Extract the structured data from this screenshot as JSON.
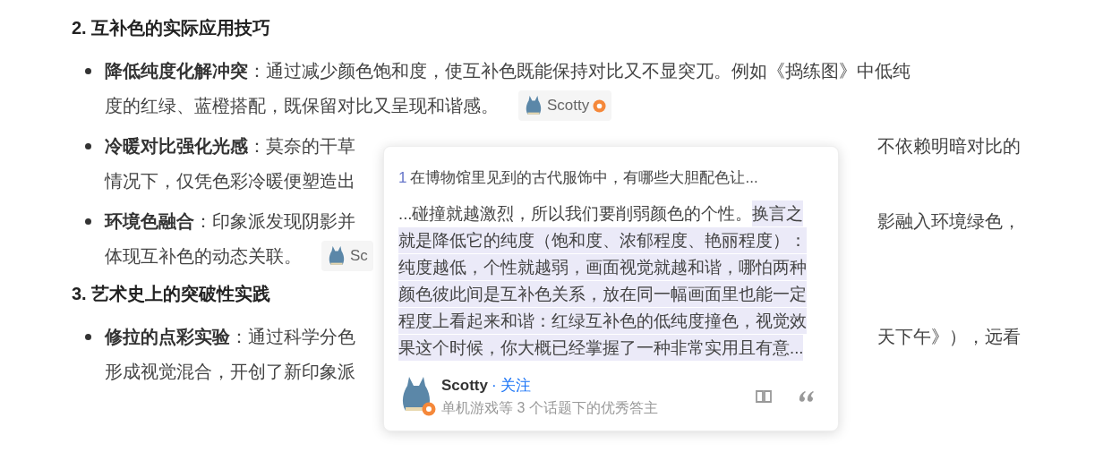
{
  "sections": [
    {
      "heading": "2. 互补色的实际应用技巧",
      "bullets": [
        {
          "lines": [
            {
              "left": "**降低纯度化解冲突**：通过减少颜色饱和度，使互补色既能保持对比又不显突兀。例如《捣练图》中低纯"
            },
            {
              "left": "度的红绿、蓝橙搭配，既保留对比又呈现和谐感。",
              "chip": {
                "name": "Scotty",
                "badge": true
              }
            }
          ]
        },
        {
          "lines": [
            {
              "left": "**冷暖对比强化光感**：莫奈的干草",
              "right": "不依赖明暗对比的"
            },
            {
              "left": "情况下，仅凭色彩冷暖便塑造出"
            }
          ]
        },
        {
          "lines": [
            {
              "left": "**环境色融合**：印象派发现阴影并",
              "right": "影融入环境绿色，"
            },
            {
              "left": "体现互补色的动态关联。",
              "chip": {
                "name": "Sc",
                "badge": false
              }
            }
          ]
        }
      ]
    },
    {
      "heading": "3. 艺术史上的突破性实践",
      "bullets": [
        {
          "lines": [
            {
              "left": "**修拉的点彩实验**：通过科学分色",
              "right": "天下午》），远看"
            },
            {
              "left": "形成视觉混合，开创了新印象派"
            }
          ]
        }
      ]
    }
  ],
  "popup": {
    "index": "1",
    "question": "在博物馆里见到的古代服饰中，有哪些大胆配色让...",
    "excerpt_plain": "...碰撞就越激烈，所以我们要削弱颜色的个性。",
    "excerpt_highlighted": "换言之就是降低它的纯度（饱和度、浓郁程度、艳丽程度）：纯度越低，个性就越弱，画面视觉就越和谐，哪怕两种颜色彼此间是互补色关系，放在同一幅画面里也能一定程度上看起来和谐：红绿互补色的低纯度撞色，视觉效果这个时候，你大概已经掌握了一种非常实用且有意...",
    "author": "Scotty",
    "follow": "· 关注",
    "author_desc": "单机游戏等 3 个话题下的优秀答主"
  }
}
